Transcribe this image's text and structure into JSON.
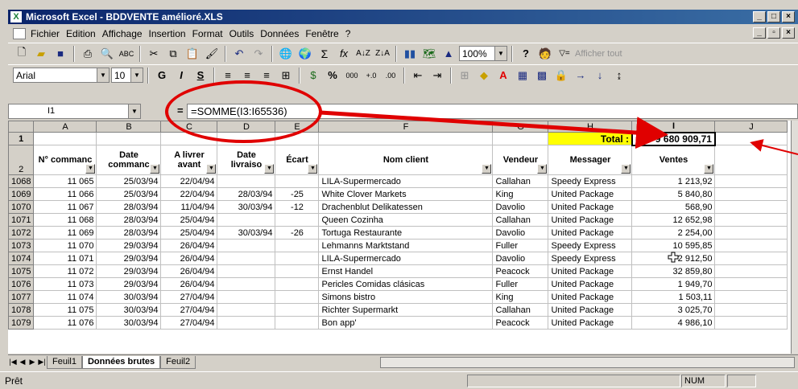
{
  "window": {
    "title": "Microsoft Excel - BDDVENTE amélioré.XLS",
    "logo": "X"
  },
  "menu": [
    "Fichier",
    "Edition",
    "Affichage",
    "Insertion",
    "Format",
    "Outils",
    "Données",
    "Fenêtre",
    "?"
  ],
  "toolbar1": {
    "zoom": "100%",
    "show_all": "Afficher tout"
  },
  "toolbar2": {
    "font": "Arial",
    "size": "10",
    "bold": "G",
    "italic": "I",
    "underline": "S",
    "percent": "%",
    "thousands": "000"
  },
  "formula": {
    "cell_ref": "I1",
    "equals": "=",
    "content": "=SOMME(I3:I65536)"
  },
  "columns": [
    "A",
    "B",
    "C",
    "D",
    "E",
    "F",
    "G",
    "H",
    "I",
    "J"
  ],
  "header_row": {
    "row_num": "2",
    "cols": [
      "N° commanc",
      "Date commanc",
      "A livrer avant",
      "Date livraiso",
      "Écart",
      "Nom client",
      "Vendeur",
      "Messager",
      "Ventes"
    ]
  },
  "total_row": {
    "row_num": "1",
    "label": "Total :",
    "value": "9 680 909,71"
  },
  "rows": [
    {
      "n": "1068",
      "a": "11 065",
      "b": "25/03/94",
      "c": "22/04/94",
      "d": "",
      "e": "",
      "f": "LILA-Supermercado",
      "g": "Callahan",
      "h": "Speedy Express",
      "i": "1 213,92"
    },
    {
      "n": "1069",
      "a": "11 066",
      "b": "25/03/94",
      "c": "22/04/94",
      "d": "28/03/94",
      "e": "-25",
      "f": "White Clover Markets",
      "g": "King",
      "h": "United Package",
      "i": "5 840,80"
    },
    {
      "n": "1070",
      "a": "11 067",
      "b": "28/03/94",
      "c": "11/04/94",
      "d": "30/03/94",
      "e": "-12",
      "f": "Drachenblut Delikatessen",
      "g": "Davolio",
      "h": "United Package",
      "i": "568,90"
    },
    {
      "n": "1071",
      "a": "11 068",
      "b": "28/03/94",
      "c": "25/04/94",
      "d": "",
      "e": "",
      "f": "Queen Cozinha",
      "g": "Callahan",
      "h": "United Package",
      "i": "12 652,98"
    },
    {
      "n": "1072",
      "a": "11 069",
      "b": "28/03/94",
      "c": "25/04/94",
      "d": "30/03/94",
      "e": "-26",
      "f": "Tortuga Restaurante",
      "g": "Davolio",
      "h": "United Package",
      "i": "2 254,00"
    },
    {
      "n": "1073",
      "a": "11 070",
      "b": "29/03/94",
      "c": "26/04/94",
      "d": "",
      "e": "",
      "f": "Lehmanns Marktstand",
      "g": "Fuller",
      "h": "Speedy Express",
      "i": "10 595,85"
    },
    {
      "n": "1074",
      "a": "11 071",
      "b": "29/03/94",
      "c": "26/04/94",
      "d": "",
      "e": "",
      "f": "LILA-Supermercado",
      "g": "Davolio",
      "h": "Speedy Express",
      "i": "2 912,50"
    },
    {
      "n": "1075",
      "a": "11 072",
      "b": "29/03/94",
      "c": "26/04/94",
      "d": "",
      "e": "",
      "f": "Ernst Handel",
      "g": "Peacock",
      "h": "United Package",
      "i": "32 859,80"
    },
    {
      "n": "1076",
      "a": "11 073",
      "b": "29/03/94",
      "c": "26/04/94",
      "d": "",
      "e": "",
      "f": "Pericles Comidas clásicas",
      "g": "Fuller",
      "h": "United Package",
      "i": "1 949,70"
    },
    {
      "n": "1077",
      "a": "11 074",
      "b": "30/03/94",
      "c": "27/04/94",
      "d": "",
      "e": "",
      "f": "Simons bistro",
      "g": "King",
      "h": "United Package",
      "i": "1 503,11"
    },
    {
      "n": "1078",
      "a": "11 075",
      "b": "30/03/94",
      "c": "27/04/94",
      "d": "",
      "e": "",
      "f": "Richter Supermarkt",
      "g": "Callahan",
      "h": "United Package",
      "i": "3 025,70"
    },
    {
      "n": "1079",
      "a": "11 076",
      "b": "30/03/94",
      "c": "27/04/94",
      "d": "",
      "e": "",
      "f": "Bon app'",
      "g": "Peacock",
      "h": "United Package",
      "i": "4 986,10"
    }
  ],
  "sheets": {
    "tab1": "Feuil1",
    "tab2": "Données brutes",
    "tab3": "Feuil2"
  },
  "status": {
    "ready": "Prêt",
    "num": "NUM"
  },
  "accent": {
    "callout": "#e00000",
    "total_bg": "#ffff00",
    "title_bar": "#0a246a"
  }
}
